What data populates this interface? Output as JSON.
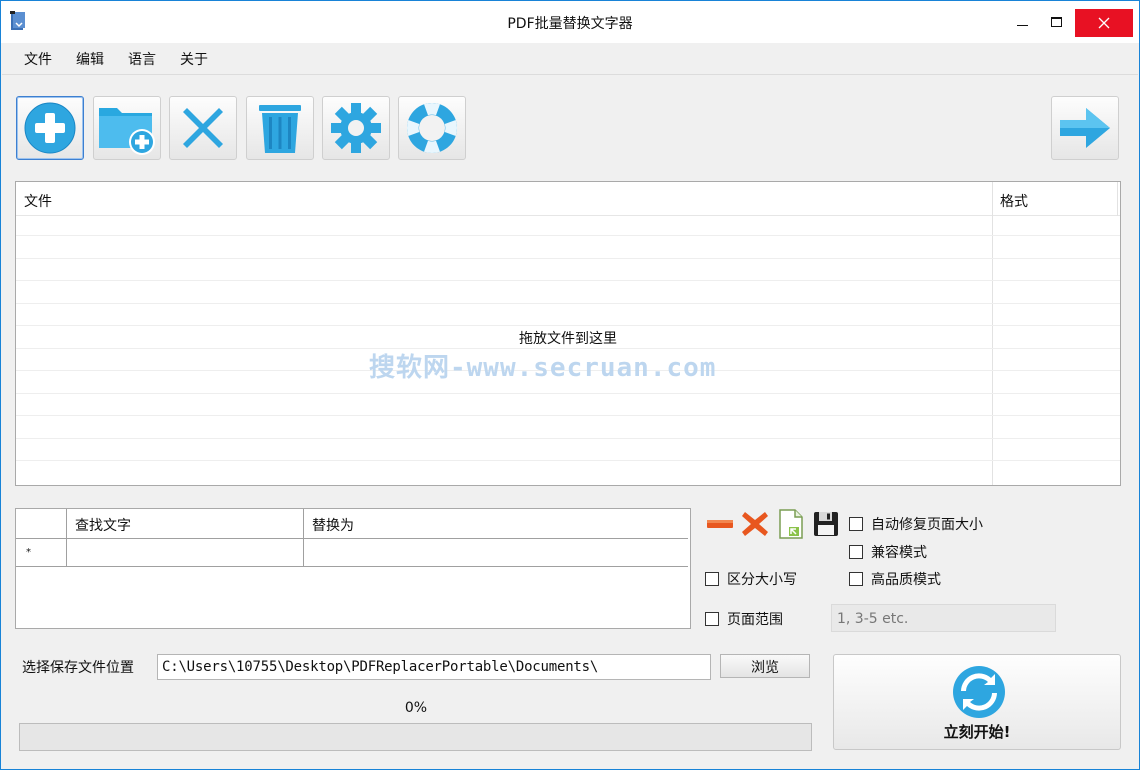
{
  "window": {
    "title": "PDF批量替换文字器"
  },
  "menu": {
    "items": [
      "文件",
      "编辑",
      "语言",
      "关于"
    ]
  },
  "toolbar": {
    "buttons": [
      {
        "name": "add-file",
        "icon": "plus-circle-icon"
      },
      {
        "name": "add-folder",
        "icon": "folder-plus-icon"
      },
      {
        "name": "remove",
        "icon": "x-icon"
      },
      {
        "name": "clear",
        "icon": "trash-icon"
      },
      {
        "name": "settings",
        "icon": "gear-icon"
      },
      {
        "name": "help",
        "icon": "lifebuoy-icon"
      },
      {
        "name": "next",
        "icon": "arrow-right-icon"
      }
    ]
  },
  "filelist": {
    "columns": [
      "文件",
      "格式"
    ],
    "drop_hint": "拖放文件到这里",
    "watermark": "搜软网-www.secruan.com"
  },
  "replace_table": {
    "columns": [
      "查找文字",
      "替换为"
    ],
    "new_row_marker": "*"
  },
  "options": {
    "auto_fix_page_size": {
      "label": "自动修复页面大小",
      "checked": false
    },
    "compatible_mode": {
      "label": "兼容模式",
      "checked": false
    },
    "case_sensitive": {
      "label": "区分大小写",
      "checked": false
    },
    "high_quality_mode": {
      "label": "高品质模式",
      "checked": false
    },
    "page_range": {
      "label": "页面范围",
      "checked": false,
      "placeholder": "1, 3-5 etc."
    }
  },
  "output": {
    "label": "选择保存文件位置",
    "path": "C:\\Users\\10755\\Desktop\\PDFReplacerPortable\\Documents\\",
    "browse_label": "浏览"
  },
  "progress": {
    "text": "0%",
    "value": 0
  },
  "start": {
    "label": "立刻开始!"
  },
  "colors": {
    "accent_blue": "#29a8e0",
    "close_red": "#e81123"
  }
}
